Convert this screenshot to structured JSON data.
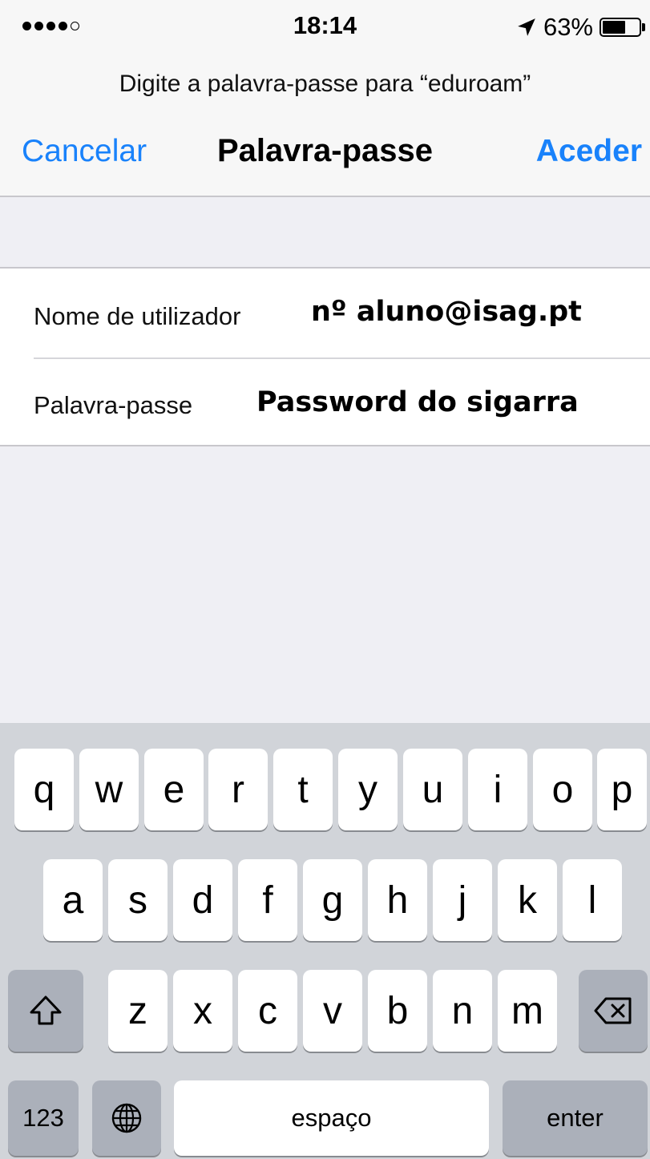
{
  "status_bar": {
    "time": "18:14",
    "battery_percent": "63%",
    "battery_level": 0.63,
    "signal_bars_filled": 4,
    "signal_bars_total": 5,
    "icons": [
      "signal-dots-icon",
      "location-arrow-icon",
      "battery-icon"
    ]
  },
  "nav": {
    "prompt": "Digite a palavra-passe para “eduroam”",
    "cancel_label": "Cancelar",
    "title": "Palavra-passe",
    "join_label": "Aceder",
    "accent_color": "#1982fb"
  },
  "form": {
    "username_label": "Nome de utilizador",
    "username_value": "nº aluno@isag.pt",
    "password_label": "Palavra-passe",
    "password_value": "Password do sigarra"
  },
  "keyboard": {
    "row1": [
      "q",
      "w",
      "e",
      "r",
      "t",
      "y",
      "u",
      "i",
      "o",
      "p"
    ],
    "row2": [
      "a",
      "s",
      "d",
      "f",
      "g",
      "h",
      "j",
      "k",
      "l"
    ],
    "row3": [
      "z",
      "x",
      "c",
      "v",
      "b",
      "n",
      "m"
    ],
    "numbers_label": "123",
    "space_label": "espaço",
    "enter_label": "enter",
    "icons": [
      "shift-icon",
      "backspace-icon",
      "globe-icon"
    ]
  }
}
